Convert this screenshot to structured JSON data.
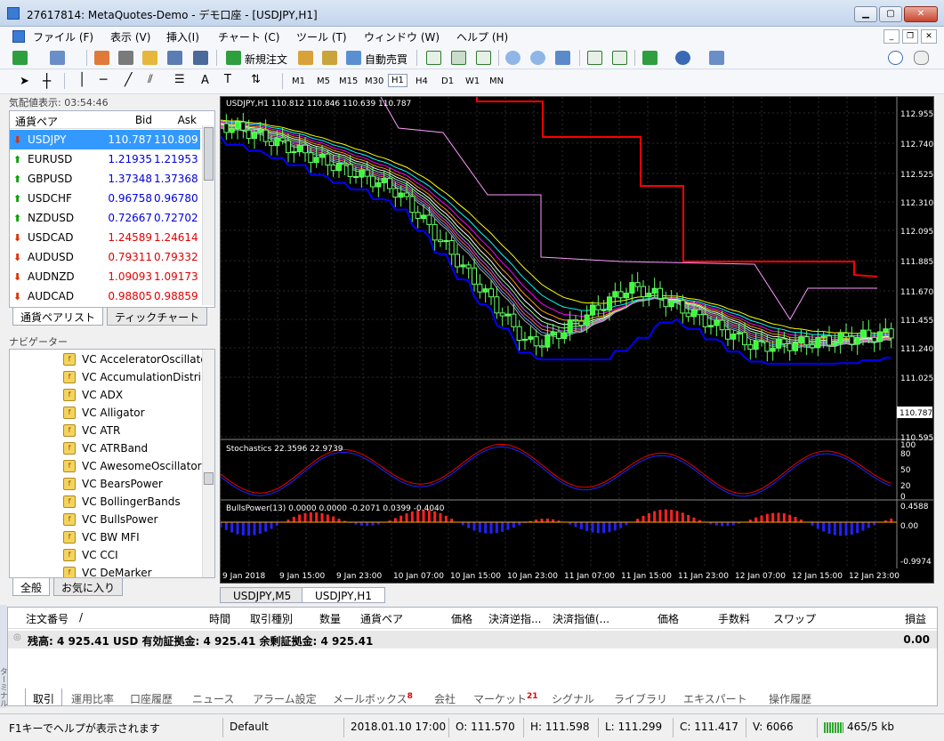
{
  "window": {
    "title": "27617814: MetaQuotes-Demo - デモ口座 - [USDJPY,H1]"
  },
  "menu": [
    "ファイル (F)",
    "表示 (V)",
    "挿入(I)",
    "チャート (C)",
    "ツール (T)",
    "ウィンドウ (W)",
    "ヘルプ (H)"
  ],
  "toolbar": {
    "new_order": "新規注文",
    "auto_trading": "自動売買",
    "timeframes": [
      "M1",
      "M5",
      "M15",
      "M30",
      "H1",
      "H4",
      "D1",
      "W1",
      "MN"
    ],
    "active_timeframe": "H1"
  },
  "market_watch": {
    "header": "気配値表示: 03:54:46",
    "columns": [
      "通貨ペア",
      "Bid",
      "Ask"
    ],
    "rows": [
      {
        "symbol": "USDJPY",
        "bid": "110.787",
        "ask": "110.809",
        "dir": "down"
      },
      {
        "symbol": "EURUSD",
        "bid": "1.21935",
        "ask": "1.21953",
        "dir": "up"
      },
      {
        "symbol": "GBPUSD",
        "bid": "1.37348",
        "ask": "1.37368",
        "dir": "up"
      },
      {
        "symbol": "USDCHF",
        "bid": "0.96758",
        "ask": "0.96780",
        "dir": "up"
      },
      {
        "symbol": "NZDUSD",
        "bid": "0.72667",
        "ask": "0.72702",
        "dir": "up"
      },
      {
        "symbol": "USDCAD",
        "bid": "1.24589",
        "ask": "1.24614",
        "dir": "down"
      },
      {
        "symbol": "AUDUSD",
        "bid": "0.79311",
        "ask": "0.79332",
        "dir": "down"
      },
      {
        "symbol": "AUDNZD",
        "bid": "1.09093",
        "ask": "1.09173",
        "dir": "down"
      },
      {
        "symbol": "AUDCAD",
        "bid": "0.98805",
        "ask": "0.98859",
        "dir": "down"
      }
    ],
    "tabs": [
      "通貨ペアリスト",
      "ティックチャート"
    ]
  },
  "navigator": {
    "header": "ナビゲーター",
    "items": [
      "VC AcceleratorOscillator",
      "VC AccumulationDistribu",
      "VC ADX",
      "VC Alligator",
      "VC ATR",
      "VC ATRBand",
      "VC AwesomeOscillator",
      "VC BearsPower",
      "VC BollingerBands",
      "VC BullsPower",
      "VC BW MFI",
      "VC CCI",
      "VC DeMarker"
    ],
    "tabs": [
      "全般",
      "お気に入り"
    ]
  },
  "chart": {
    "label": "USDJPY,H1  110.812 110.846 110.639 110.787",
    "price_ticks": [
      "112.955",
      "112.740",
      "112.525",
      "112.310",
      "112.095",
      "111.885",
      "111.670",
      "111.455",
      "111.240",
      "111.025",
      "110.595"
    ],
    "current_price": "110.787",
    "time_ticks": [
      "9 Jan 2018",
      "9 Jan 15:00",
      "9 Jan 23:00",
      "10 Jan 07:00",
      "10 Jan 15:00",
      "10 Jan 23:00",
      "11 Jan 07:00",
      "11 Jan 15:00",
      "11 Jan 23:00",
      "12 Jan 07:00",
      "12 Jan 15:00",
      "12 Jan 23:00"
    ],
    "stoch_label": "Stochastics 22.3596 22.9739",
    "stoch_ticks": [
      "100",
      "80",
      "50",
      "20",
      "0"
    ],
    "bulls_label": "BullsPower(13) 0.0000 0.0000 -0.2071 0.0399 -0.4040",
    "bulls_ticks": [
      "0.4588",
      "0.00",
      "-0.9974"
    ],
    "tabs": [
      "USDJPY,M5",
      "USDJPY,H1"
    ]
  },
  "terminal": {
    "side_label": "ターミナル",
    "columns": [
      "注文番号",
      "/",
      "時間",
      "取引種別",
      "数量",
      "通貨ペア",
      "価格",
      "決済逆指...",
      "決済指値(...",
      "価格",
      "手数料",
      "スワップ",
      "損益"
    ],
    "balance": "残高: 4 925.41 USD  有効証拠金: 4 925.41  余剰証拠金: 4 925.41",
    "profit": "0.00",
    "tabs": [
      {
        "label": "取引",
        "badge": ""
      },
      {
        "label": "運用比率",
        "badge": ""
      },
      {
        "label": "口座履歴",
        "badge": ""
      },
      {
        "label": "ニュース",
        "badge": ""
      },
      {
        "label": "アラーム設定",
        "badge": ""
      },
      {
        "label": "メールボックス",
        "badge": "8"
      },
      {
        "label": "会社",
        "badge": ""
      },
      {
        "label": "マーケット",
        "badge": "21"
      },
      {
        "label": "シグナル",
        "badge": ""
      },
      {
        "label": "ライブラリ",
        "badge": ""
      },
      {
        "label": "エキスパート",
        "badge": ""
      },
      {
        "label": "操作履歴",
        "badge": ""
      }
    ]
  },
  "status": {
    "help": "F1キーでヘルプが表示されます",
    "profile": "Default",
    "datetime": "2018.01.10 17:00",
    "open": "O: 111.570",
    "high": "H: 111.598",
    "low": "L: 111.299",
    "close": "C: 111.417",
    "volume": "V: 6066",
    "traffic": "465/5 kb"
  }
}
